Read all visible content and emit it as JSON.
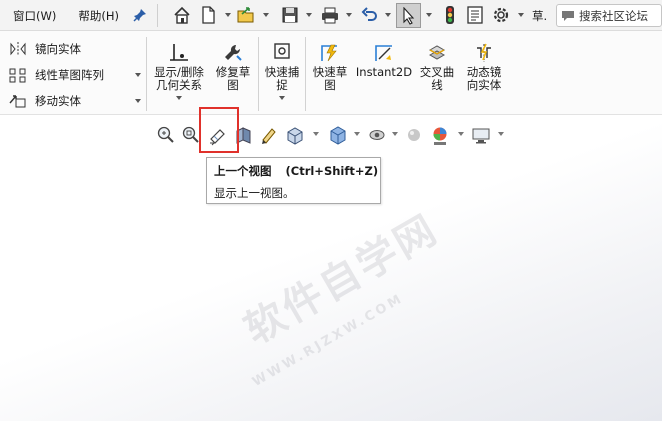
{
  "menu": [
    {
      "label": "窗口(W)"
    },
    {
      "label": "帮助(H)"
    }
  ],
  "toolbar": {
    "overflow_label": "草.",
    "search_placeholder": "搜索社区论坛"
  },
  "ribbon": {
    "list_items": [
      {
        "label": "镜向实体",
        "icon": "mirror-entities-icon"
      },
      {
        "label": "线性草图阵列",
        "icon": "linear-pattern-icon"
      },
      {
        "label": "移动实体",
        "icon": "move-entities-icon"
      }
    ],
    "buttons": [
      {
        "label": "显示/删除\n几何关系",
        "icon": "relations-icon"
      },
      {
        "label": "修复草\n图",
        "icon": "repair-sketch-icon"
      },
      {
        "label": "快速捕\n捉",
        "icon": "quick-snap-icon"
      },
      {
        "label": "快速草\n图",
        "icon": "rapid-sketch-icon"
      },
      {
        "label": "Instant2D",
        "icon": "instant2d-icon"
      },
      {
        "label": "交叉曲\n线",
        "icon": "intersection-curve-icon"
      },
      {
        "label": "动态镜\n向实体",
        "icon": "dynamic-mirror-icon"
      }
    ]
  },
  "tooltip": {
    "title": "上一个视图",
    "shortcut": "(Ctrl+Shift+Z)",
    "description": "显示上一视图。"
  },
  "watermark": {
    "text": "软件自学网",
    "url": "WWW.RJZXW.COM"
  },
  "colors": {
    "highlight": "#e0312b",
    "select_active": "#cfcfcf"
  }
}
